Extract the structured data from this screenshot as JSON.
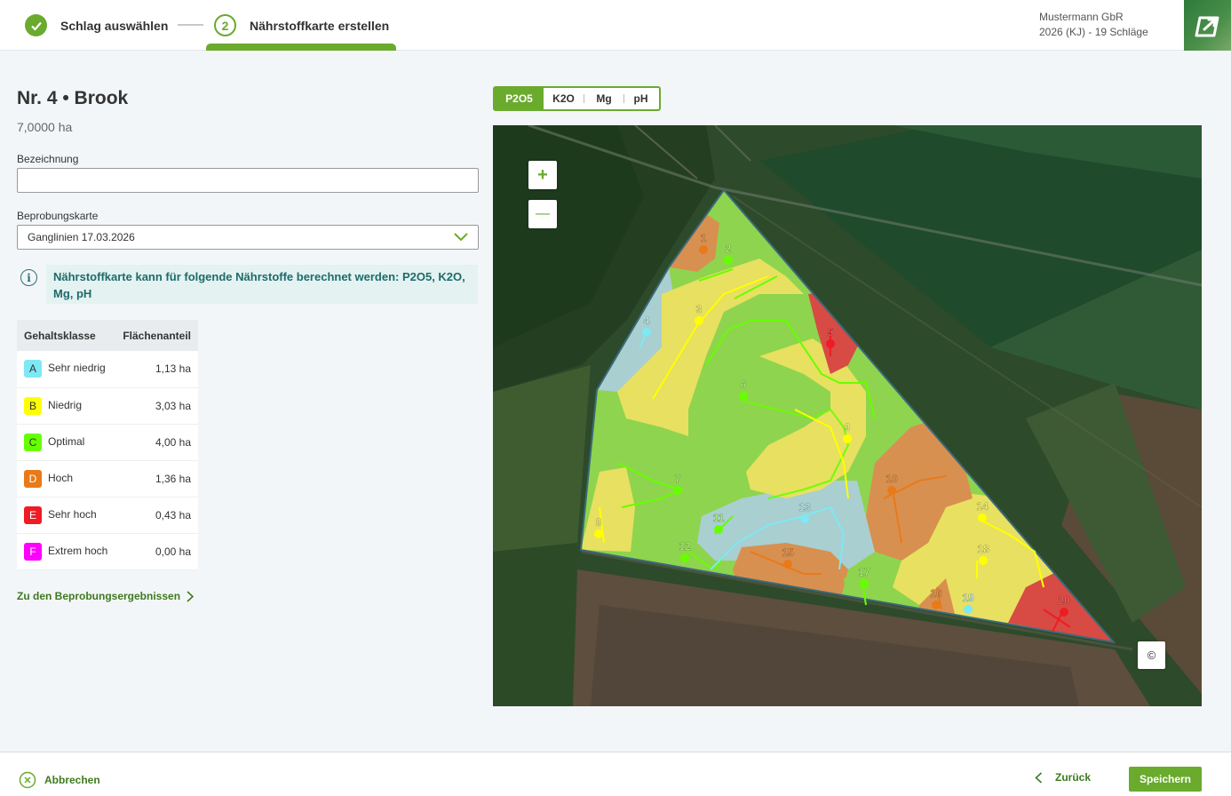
{
  "header": {
    "steps": [
      {
        "label": "Schlag auswählen",
        "state": "done"
      },
      {
        "number": "2",
        "label": "Nährstoffkarte erstellen",
        "state": "active"
      }
    ],
    "company": {
      "name": "Mustermann GbR",
      "season": "2026 (KJ) - 19 Schläge"
    },
    "accent_color": "#6aaa2d"
  },
  "field": {
    "title": "Nr. 4 • Brook",
    "area": "7,0000 ha"
  },
  "form": {
    "bezeichnung_label": "Bezeichnung",
    "bezeichnung_value": "",
    "beprobungskarte_label": "Beprobungskarte",
    "beprobungskarte_value": "Ganglinien 17.03.2026"
  },
  "info": {
    "text": "Nährstoffkarte kann für folgende Nährstoffe berechnet werden: P2O5, K2O, Mg, pH"
  },
  "class_table": {
    "headers": [
      "Gehaltsklasse",
      "Flächenanteil"
    ],
    "rows": [
      {
        "class": "A",
        "label": "Sehr niedrig",
        "area": "1,13 ha",
        "color": "#7ee8f4",
        "text_color": "#333333"
      },
      {
        "class": "B",
        "label": "Niedrig",
        "area": "3,03 ha",
        "color": "#ffff00",
        "text_color": "#333333"
      },
      {
        "class": "C",
        "label": "Optimal",
        "area": "4,00 ha",
        "color": "#66ff00",
        "text_color": "#333333"
      },
      {
        "class": "D",
        "label": "Hoch",
        "area": "1,36 ha",
        "color": "#e87a1a",
        "text_color": "#ffffff"
      },
      {
        "class": "E",
        "label": "Sehr hoch",
        "area": "0,43 ha",
        "color": "#ee1c24",
        "text_color": "#ffffff"
      },
      {
        "class": "F",
        "label": "Extrem hoch",
        "area": "0,00 ha",
        "color": "#ff00ff",
        "text_color": "#ffffff"
      }
    ]
  },
  "results_link": "Zu den Beprobungsergebnissen",
  "nutrient_tabs": {
    "items": [
      "P2O5",
      "K2O",
      "Mg",
      "pH"
    ],
    "active": "P2O5"
  },
  "map": {
    "zoom_in": "+",
    "zoom_out": "—",
    "attribution": "©",
    "sample_points": [
      {
        "id": "1",
        "class": "D"
      },
      {
        "id": "2",
        "class": "C"
      },
      {
        "id": "3",
        "class": "B"
      },
      {
        "id": "4",
        "class": "A"
      },
      {
        "id": "5",
        "class": "E"
      },
      {
        "id": "6",
        "class": "C"
      },
      {
        "id": "7",
        "class": "C"
      },
      {
        "id": "8",
        "class": "B"
      },
      {
        "id": "9",
        "class": "B"
      },
      {
        "id": "10",
        "class": "D"
      },
      {
        "id": "11",
        "class": "C"
      },
      {
        "id": "12",
        "class": "C"
      },
      {
        "id": "13",
        "class": "A"
      },
      {
        "id": "14",
        "class": "B"
      },
      {
        "id": "15",
        "class": "D"
      },
      {
        "id": "16",
        "class": "D"
      },
      {
        "id": "17",
        "class": "C"
      },
      {
        "id": "18",
        "class": "B"
      },
      {
        "id": "19",
        "class": "A"
      },
      {
        "id": "20",
        "class": "E"
      }
    ]
  },
  "footer": {
    "cancel": "Abbrechen",
    "back": "Zurück",
    "save": "Speichern"
  }
}
